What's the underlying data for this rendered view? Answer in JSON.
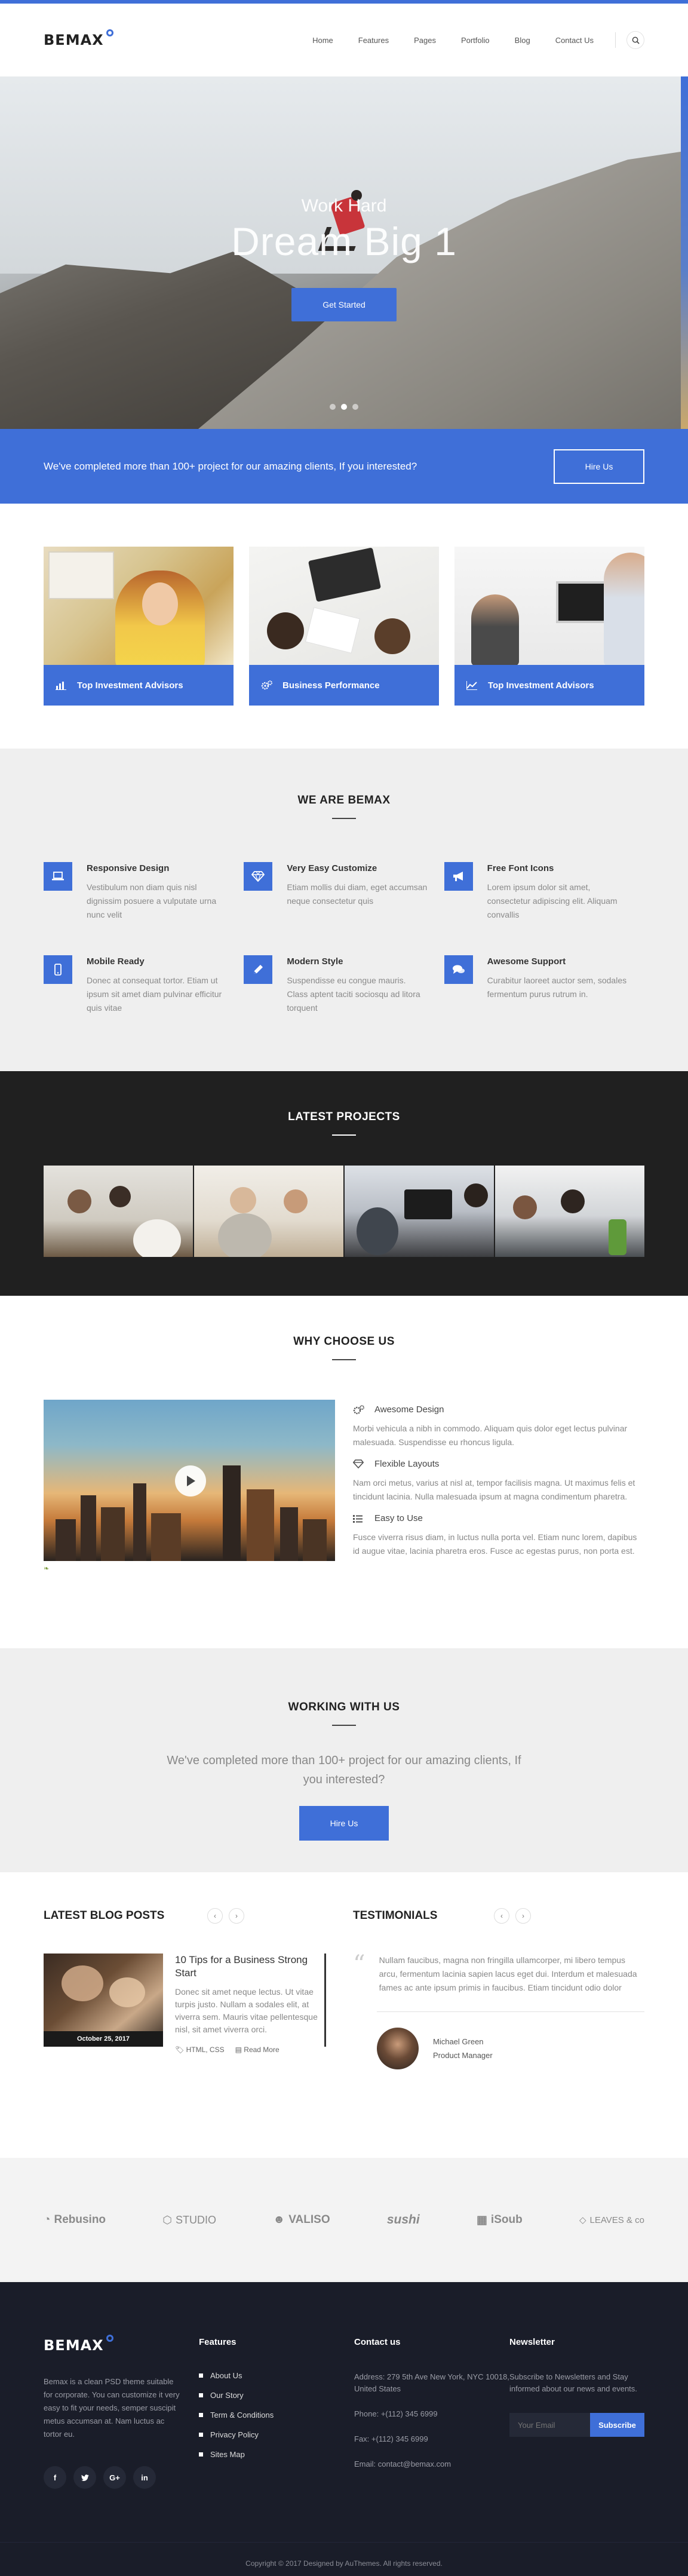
{
  "brand": {
    "name": "BEMAX"
  },
  "nav": {
    "items": [
      "Home",
      "Features",
      "Pages",
      "Portfolio",
      "Blog",
      "Contact Us"
    ]
  },
  "hero": {
    "subtitle": "Work Hard",
    "title": "Dream Big 1",
    "button": "Get Started",
    "slides": 3,
    "active_slide": 2
  },
  "cta": {
    "text": "We've completed more than 100+ project for our amazing clients, If you interested?",
    "button": "Hire Us"
  },
  "cards": [
    {
      "label": "Top Investment Advisors",
      "icon": "chart-icon"
    },
    {
      "label": "Business Performance",
      "icon": "gears-icon"
    },
    {
      "label": "Top Investment Advisors",
      "icon": "line-chart-icon"
    }
  ],
  "weare": {
    "title": "WE ARE BEMAX",
    "features": [
      {
        "title": "Responsive Design",
        "text": "Vestibulum non diam quis nisl dignissim posuere a vulputate urna nunc velit",
        "icon": "laptop-icon"
      },
      {
        "title": "Very Easy Customize",
        "text": "Etiam mollis dui diam, eget accumsan neque consectetur quis",
        "icon": "diamond-icon"
      },
      {
        "title": "Free Font Icons",
        "text": "Lorem ipsum dolor sit amet, consectetur adipiscing elit. Aliquam convallis",
        "icon": "bullhorn-icon"
      },
      {
        "title": "Mobile Ready",
        "text": "Donec at consequat tortor. Etiam ut ipsum sit amet diam pulvinar efficitur quis vitae",
        "icon": "mobile-icon"
      },
      {
        "title": "Modern Style",
        "text": "Suspendisse eu congue mauris. Class aptent taciti sociosqu ad litora torquent",
        "icon": "pencil-icon"
      },
      {
        "title": "Awesome Support",
        "text": "Curabitur laoreet auctor sem, sodales fermentum purus rutrum in.",
        "icon": "comments-icon"
      }
    ]
  },
  "projects": {
    "title": "LATEST PROJECTS"
  },
  "why": {
    "title": "WHY CHOOSE US",
    "items": [
      {
        "title": "Awesome Design",
        "text": "Morbi vehicula a nibh in commodo. Aliquam quis dolor eget lectus pulvinar malesuada. Suspendisse eu rhoncus ligula.",
        "icon": "gears-icon"
      },
      {
        "title": "Flexible Layouts",
        "text": "Nam orci metus, varius at nisl at, tempor facilisis magna. Ut maximus felis et tincidunt lacinia. Nulla malesuada ipsum at magna condimentum pharetra.",
        "icon": "diamond-icon"
      },
      {
        "title": "Easy to Use",
        "text": "Fusce viverra risus diam, in luctus nulla porta vel. Etiam nunc lorem, dapibus id augue vitae, lacinia pharetra eros. Fusce ac egestas purus, non porta est.",
        "icon": "list-icon"
      }
    ]
  },
  "working": {
    "title": "WORKING WITH US",
    "text": "We've completed more than 100+ project for our amazing clients, If you interested?",
    "button": "Hire Us"
  },
  "blog": {
    "title": "LATEST BLOG POSTS",
    "post": {
      "date": "October 25, 2017",
      "title": "10 Tips for a Business Strong Start",
      "text": "Donec sit amet neque lectus. Ut vitae turpis justo. Nullam a sodales elit, at viverra sem. Mauris vitae pellentesque nisl, sit amet viverra orci.",
      "tags": "HTML, CSS",
      "read_more": "Read More"
    }
  },
  "testimonials": {
    "title": "TESTIMONIALS",
    "quote": "Nullam faucibus, magna non fringilla ullamcorper, mi libero tempus arcu, fermentum lacinia sapien lacus eget dui. Interdum et malesuada fames ac ante ipsum primis in faucibus. Etiam tincidunt odio dolor",
    "author": "Michael Green",
    "role": "Product Manager"
  },
  "brands": [
    "Rebusino",
    "STUDIO",
    "VALISO",
    "sushi",
    "iSoub",
    "LEAVES & co"
  ],
  "footer": {
    "about": "Bemax is a clean PSD theme suitable for corporate. You can customize it very easy to fit your needs, semper suscipit metus accumsan at. Nam luctus ac tortor eu.",
    "socials": [
      "f",
      "t",
      "G+",
      "in"
    ],
    "features_title": "Features",
    "features": [
      "About Us",
      "Our Story",
      "Term & Conditions",
      "Privacy Policy",
      "Sites Map"
    ],
    "contact_title": "Contact us",
    "address": "Address: 279 5th Ave New York, NYC 10018, United States",
    "phone": "Phone: +(112) 345 6999",
    "fax": "Fax: +(112) 345 6999",
    "email": "Email: contact@bemax.com",
    "newsletter_title": "Newsletter",
    "newsletter_text": "Subscribe to Newsletters and Stay informed about our news and events.",
    "email_placeholder": "Your Email",
    "subscribe": "Subscribe",
    "copyright": "Copyright © 2017 Designed by AuThemes. All rights reserved."
  },
  "colors": {
    "accent": "#3f6fd8",
    "dark": "#202020",
    "footer": "#1a1d29"
  }
}
